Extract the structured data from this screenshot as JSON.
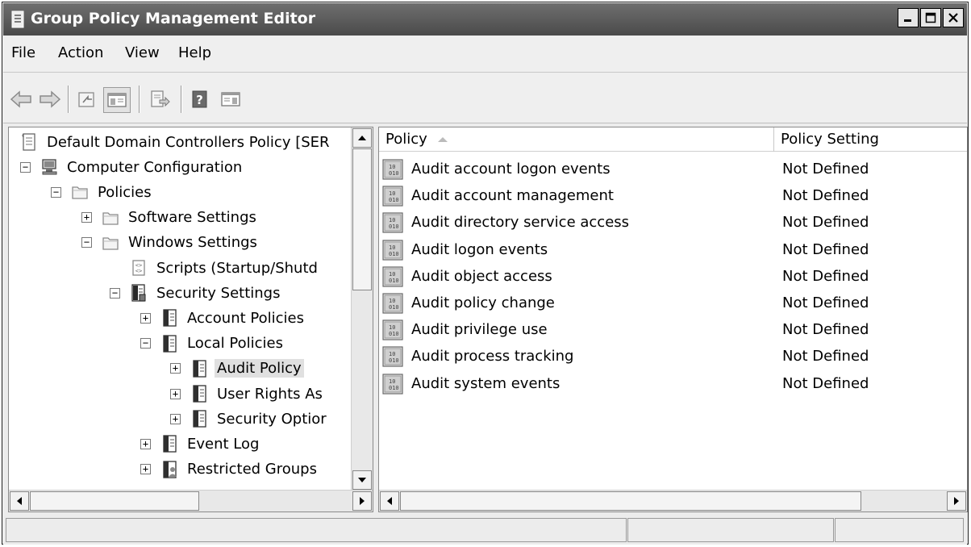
{
  "window": {
    "title": "Group Policy Management Editor"
  },
  "menu": [
    "File",
    "Action",
    "View",
    "Help"
  ],
  "toolbar": {
    "buttons": [
      "back-icon",
      "forward-icon",
      "up-folder-icon",
      "show-hide-tree-icon",
      "export-list-icon",
      "help-icon",
      "show-hide-action-pane-icon"
    ]
  },
  "tree": {
    "items": [
      {
        "label": "Default Domain Controllers Policy [SER",
        "icon": "gpo-scroll-icon",
        "expander": ""
      },
      {
        "label": "Computer Configuration",
        "icon": "computer-icon",
        "expander": "−"
      },
      {
        "label": "Policies",
        "icon": "folder-icon",
        "expander": "−"
      },
      {
        "label": "Software Settings",
        "icon": "folder-icon",
        "expander": "+"
      },
      {
        "label": "Windows Settings",
        "icon": "folder-icon",
        "expander": "−"
      },
      {
        "label": "Scripts (Startup/Shutd",
        "icon": "script-icon",
        "expander": ""
      },
      {
        "label": "Security Settings",
        "icon": "security-settings-icon",
        "expander": "−"
      },
      {
        "label": "Account Policies",
        "icon": "policy-book-icon",
        "expander": "+"
      },
      {
        "label": "Local Policies",
        "icon": "policy-book-icon",
        "expander": "−"
      },
      {
        "label": "Audit Policy",
        "icon": "policy-book-icon",
        "expander": "+",
        "selected": true
      },
      {
        "label": "User Rights As",
        "icon": "policy-book-icon",
        "expander": "+"
      },
      {
        "label": "Security Optior",
        "icon": "policy-book-icon",
        "expander": "+"
      },
      {
        "label": "Event Log",
        "icon": "policy-book-icon",
        "expander": "+"
      },
      {
        "label": "Restricted Groups",
        "icon": "restricted-groups-icon",
        "expander": "+"
      }
    ]
  },
  "list": {
    "columns": [
      "Policy",
      "Policy Setting"
    ],
    "sort_column": "Policy",
    "rows": [
      {
        "policy": "Audit account logon events",
        "setting": "Not Defined"
      },
      {
        "policy": "Audit account management",
        "setting": "Not Defined"
      },
      {
        "policy": "Audit directory service access",
        "setting": "Not Defined"
      },
      {
        "policy": "Audit logon events",
        "setting": "Not Defined"
      },
      {
        "policy": "Audit object access",
        "setting": "Not Defined"
      },
      {
        "policy": "Audit policy change",
        "setting": "Not Defined"
      },
      {
        "policy": "Audit privilege use",
        "setting": "Not Defined"
      },
      {
        "policy": "Audit process tracking",
        "setting": "Not Defined"
      },
      {
        "policy": "Audit system events",
        "setting": "Not Defined"
      }
    ]
  },
  "statusbar": {
    "cells": [
      "",
      "",
      ""
    ]
  }
}
